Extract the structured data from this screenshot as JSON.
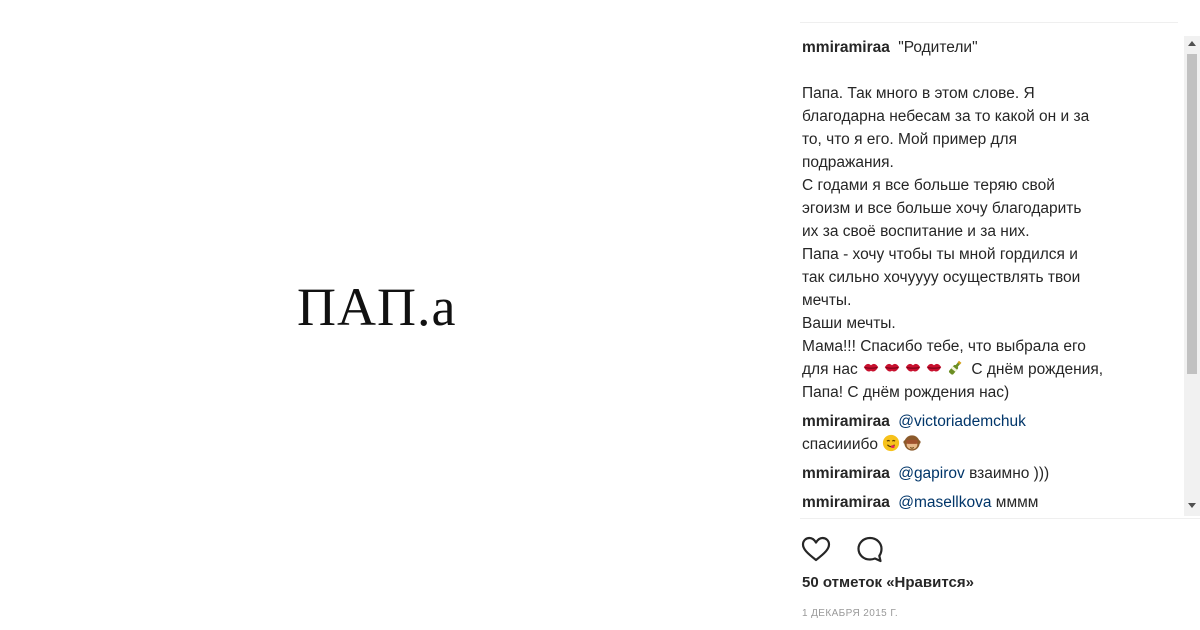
{
  "post": {
    "image_text": "ПАП.а"
  },
  "caption": {
    "username": "mmiramiraa",
    "title": "\"Родители\"",
    "body_lines": [
      "Папа. Так много в этом слове. Я",
      "благодарна небесам за то какой он и за",
      "то, что я его. Мой пример для",
      "подражания.",
      "С годами я все больше теряю свой",
      "эгоизм и все больше хочу благодарить",
      "их за своё воспитание и за них.",
      "Папа - хочу чтобы ты мной гордился и",
      "так сильно хочуууу осуществлять твои",
      "мечты.",
      "Ваши мечты.",
      "Мама!!! Спасибо тебе, что выбрала его"
    ],
    "last_line_prefix": "для нас",
    "last_line_suffix": "С днём рождения,",
    "final_line": "Папа! С днём рождения нас)",
    "emoji_names": [
      "kiss-mark",
      "kiss-mark",
      "kiss-mark",
      "kiss-mark",
      "champagne-bottle"
    ]
  },
  "comments": [
    {
      "username": "mmiramiraa",
      "mention": "@victoriademchuk",
      "text": "спасииибо",
      "emojis": [
        "yum-face",
        "see-no-evil-monkey"
      ]
    },
    {
      "username": "mmiramiraa",
      "mention": "@gapirov",
      "text": "взаимно )))"
    },
    {
      "username": "mmiramiraa",
      "mention": "@masellkova",
      "text": "мммм"
    }
  ],
  "likes_text": "50 отметок «Нравится»",
  "date_text": "1 ДЕКАБРЯ 2015 Г.",
  "colors": {
    "text": "#262626",
    "mention": "#003569",
    "muted": "#999999",
    "kiss": "#c8102e"
  }
}
